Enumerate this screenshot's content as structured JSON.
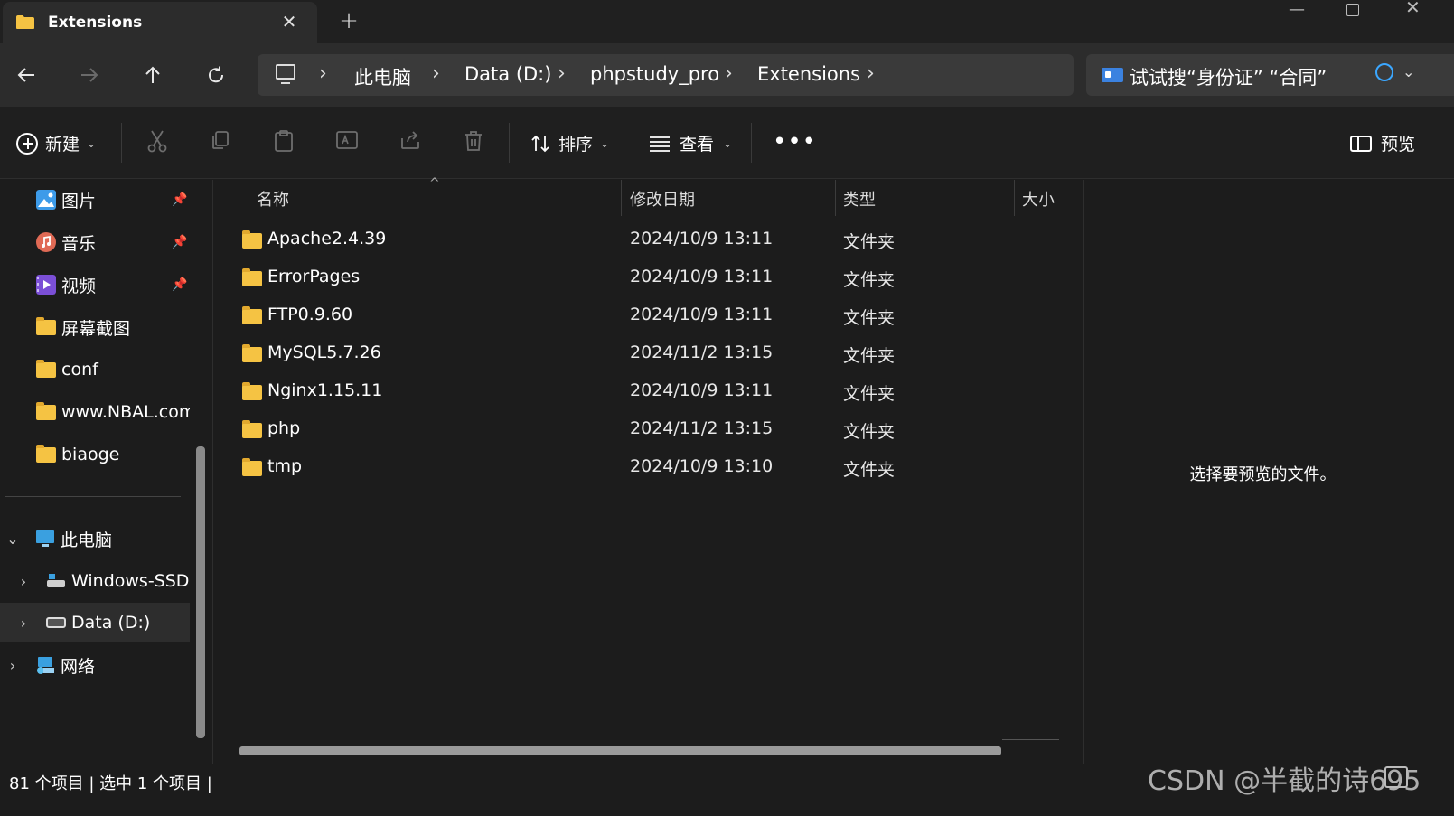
{
  "window": {
    "tab_title": "Extensions",
    "new_tab": "+",
    "close_tab": "✕",
    "minimize": "—",
    "close": "✕"
  },
  "address": {
    "breadcrumbs": [
      "此电脑",
      "Data (D:)",
      "phpstudy_pro",
      "Extensions"
    ],
    "search_text": "试试搜“身份证” “合同”"
  },
  "toolbar": {
    "new_label": "新建",
    "sort_label": "排序",
    "view_label": "查看",
    "more_label": "•••",
    "preview_label": "预览"
  },
  "sidebar": {
    "quick_access": [
      {
        "label": "图片",
        "icon": "pictures-icon",
        "pinned": true
      },
      {
        "label": "音乐",
        "icon": "music-icon",
        "pinned": true
      },
      {
        "label": "视频",
        "icon": "videos-icon",
        "pinned": true
      },
      {
        "label": "屏幕截图",
        "icon": "folder-icon",
        "pinned": false
      },
      {
        "label": "conf",
        "icon": "folder-icon",
        "pinned": false
      },
      {
        "label": "www.NBAL.com",
        "icon": "folder-icon",
        "pinned": false
      },
      {
        "label": "biaoge",
        "icon": "folder-icon",
        "pinned": false
      }
    ],
    "this_pc": "此电脑",
    "drives": [
      "Windows-SSD (C:)",
      "Data (D:)"
    ],
    "network": "网络",
    "pin_glyph": "📌",
    "expand_glyph": "⌄",
    "collapse_glyph": "›"
  },
  "columns": {
    "name": "名称",
    "modified": "修改日期",
    "type": "类型",
    "size": "大小"
  },
  "files": [
    {
      "name": "Apache2.4.39",
      "modified": "2024/10/9 13:11",
      "type": "文件夹"
    },
    {
      "name": "ErrorPages",
      "modified": "2024/10/9 13:11",
      "type": "文件夹"
    },
    {
      "name": "FTP0.9.60",
      "modified": "2024/10/9 13:11",
      "type": "文件夹"
    },
    {
      "name": "MySQL5.7.26",
      "modified": "2024/11/2 13:15",
      "type": "文件夹"
    },
    {
      "name": "Nginx1.15.11",
      "modified": "2024/10/9 13:11",
      "type": "文件夹"
    },
    {
      "name": "php",
      "modified": "2024/11/2 13:15",
      "type": "文件夹"
    },
    {
      "name": "tmp",
      "modified": "2024/10/9 13:10",
      "type": "文件夹"
    }
  ],
  "preview_pane": {
    "message": "选择要预览的文件。"
  },
  "status": {
    "text": "81 个项目  |  选中 1 个项目  |",
    "watermark": "CSDN @半截的诗695"
  },
  "colors": {
    "folder": "#f5c343",
    "accent": "#3b82e0",
    "background": "#1c1c1c"
  }
}
